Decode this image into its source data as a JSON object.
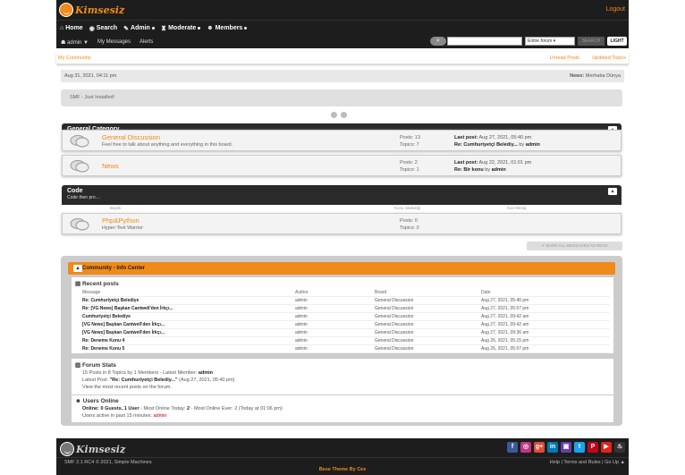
{
  "header": {
    "logo_text": "Kimsesiz",
    "logout": "Logout"
  },
  "nav": [
    {
      "label": "Home",
      "icon": "home-icon",
      "glyph": "⌂"
    },
    {
      "label": "Search",
      "icon": "search-icon",
      "glyph": "◉"
    },
    {
      "label": "Admin",
      "icon": "wrench-icon",
      "glyph": "✎"
    },
    {
      "label": "Moderate",
      "icon": "shield-icon",
      "glyph": "♜"
    },
    {
      "label": "Members",
      "icon": "members-icon",
      "glyph": "☻"
    }
  ],
  "userbar": {
    "user": "admin ▼",
    "messages": "My Messages",
    "alerts": "Alerts"
  },
  "search": {
    "scope": "Entire forum",
    "button": "SEARCH",
    "light": "LIGHT"
  },
  "breadcrumb": {
    "home": "My Community",
    "unread": "Unread Posts",
    "updated": "Updated Topics"
  },
  "datebar": {
    "date": "Aug 31, 2021, 04:11 pm",
    "news_label": "News:",
    "news_value": "Merhaba Dünya"
  },
  "news_text": "SMF - Just Installed!",
  "categories": [
    {
      "title": "General Category",
      "boards": [
        {
          "name": "General Discussion",
          "desc": "Feel free to talk about anything and everything in this board.",
          "posts": "Posts: 13",
          "topics": "Topics: 7",
          "lastpost_label": "Last post:",
          "lastpost_date": "Aug 27, 2021, 05:40 pm",
          "lastpost_re": "Re: Cumhuriyetçi Belediy...",
          "lastpost_by": "by",
          "lastpost_user": "admin"
        },
        {
          "name": "News",
          "desc": "",
          "posts": "Posts: 2",
          "topics": "Topics: 1",
          "lastpost_label": "Last post:",
          "lastpost_date": "Aug 22, 2021, 01:01 pm",
          "lastpost_re": "Re: Bir konu",
          "lastpost_by": "by",
          "lastpost_user": "admin"
        }
      ]
    },
    {
      "title": "Code",
      "subtitle": "Code then pro....",
      "columns": [
        "Başlık",
        "Konu istatistiği",
        "Son Mesaj"
      ],
      "boards": [
        {
          "name": "Php&Python",
          "desc": "Hyper-Text Warrior",
          "posts": "Posts: 0",
          "topics": "Topics: 0"
        }
      ]
    }
  ],
  "mark_read": "MARK ALL MESSAGES AS READ",
  "info_center": {
    "title": "My Community - Info Center",
    "recent_title": "Recent posts",
    "recent_headers": [
      "Message",
      "Author",
      "Board",
      "Date"
    ],
    "recent": [
      [
        "Re: Cumhuriyetçi Belediye",
        "admin",
        "General Discussion",
        "Aug 27, 2021, 05:40 pm"
      ],
      [
        "Re: [VG News] Başkan Cantwell'den İrkçı...",
        "admin",
        "General Discussion",
        "Aug 27, 2021, 05:07 pm"
      ],
      [
        "Cumhuriyetçi Belediye",
        "admin",
        "General Discussion",
        "Aug 27, 2021, 09:42 am"
      ],
      [
        "[VG News] Başkan Cantwell'den İrkçı...",
        "admin",
        "General Discussion",
        "Aug 27, 2021, 09:42 am"
      ],
      [
        "[VG News] Başkan Cantwell'den İrkçı...",
        "admin",
        "General Discussion",
        "Aug 27, 2021, 09:36 am"
      ],
      [
        "Re: Deneme Konu 4",
        "admin",
        "General Discussion",
        "Aug 26, 2021, 05:15 pm"
      ],
      [
        "Re: Deneme Konu 5",
        "admin",
        "General Discussion",
        "Aug 26, 2021, 05:07 pm"
      ]
    ],
    "stats_title": "Forum Stats",
    "stats_line1_a": "15 Posts in 8 Topics by 1 Members - Latest Member:",
    "stats_line1_b": "admin",
    "stats_line2_a": "Latest Post:",
    "stats_line2_b": "\"Re: Cumhuriyetçi Belediy...\"",
    "stats_line2_c": "(Aug 27, 2021, 05:40 pm)",
    "stats_line3": "View the most recent posts on the forum.",
    "online_title": "Users Online",
    "online_line1_a": "Online:",
    "online_line1_b": "0 Guests, 1 User",
    "online_line1_c": "- Most Online Today:",
    "online_line1_d": "2",
    "online_line1_e": "- Most Online Ever: 2",
    "online_line1_f": "(Today at 01:06 pm)",
    "online_line2_a": "Users active in past 15 minutes:",
    "online_line2_b": "admin"
  },
  "footer": {
    "logo_text": "Kimsesiz",
    "copyright": "SMF 2.1 RC4 © 2021, Simple Machines",
    "links": "Help | Terms and Rules | Go Up ▲",
    "theme": "Bese Theme By Cee",
    "social": [
      {
        "name": "facebook-icon",
        "glyph": "f",
        "color": "#3b5998"
      },
      {
        "name": "instagram-icon",
        "glyph": "◎",
        "color": "#c13584"
      },
      {
        "name": "googleplus-icon",
        "glyph": "g+",
        "color": "#dd4b39"
      },
      {
        "name": "linkedin-icon",
        "glyph": "in",
        "color": "#0077b5"
      },
      {
        "name": "twitch-icon",
        "glyph": "▣",
        "color": "#6441a5"
      },
      {
        "name": "twitter-icon",
        "glyph": "t",
        "color": "#1da1f2"
      },
      {
        "name": "pinterest-icon",
        "glyph": "P",
        "color": "#bd081c"
      },
      {
        "name": "youtube-icon",
        "glyph": "▶",
        "color": "#e62117"
      },
      {
        "name": "steam-icon",
        "glyph": "♨",
        "color": "#333333"
      }
    ]
  }
}
